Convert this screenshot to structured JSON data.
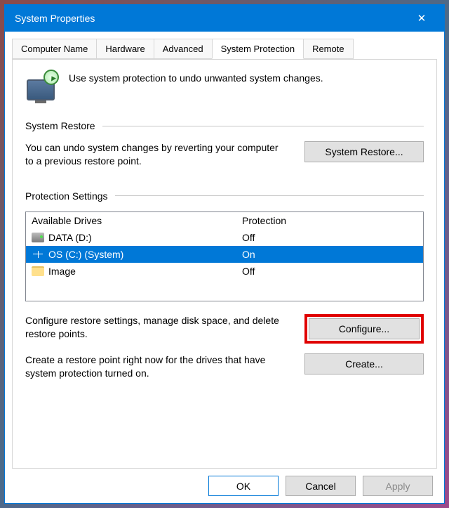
{
  "window": {
    "title": "System Properties"
  },
  "tabs": {
    "computer_name": "Computer Name",
    "hardware": "Hardware",
    "advanced": "Advanced",
    "system_protection": "System Protection",
    "remote": "Remote"
  },
  "intro_text": "Use system protection to undo unwanted system changes.",
  "restore": {
    "header": "System Restore",
    "desc": "You can undo system changes by reverting your computer to a previous restore point.",
    "button": "System Restore..."
  },
  "protection": {
    "header": "Protection Settings",
    "col_drives": "Available Drives",
    "col_protection": "Protection",
    "drives": [
      {
        "name": "DATA (D:)",
        "icon": "hdd",
        "protection": "Off",
        "selected": false
      },
      {
        "name": "OS (C:) (System)",
        "icon": "win",
        "protection": "On",
        "selected": true
      },
      {
        "name": "Image",
        "icon": "folder",
        "protection": "Off",
        "selected": false
      }
    ],
    "configure_desc": "Configure restore settings, manage disk space, and delete restore points.",
    "configure_btn": "Configure...",
    "create_desc": "Create a restore point right now for the drives that have system protection turned on.",
    "create_btn": "Create..."
  },
  "footer": {
    "ok": "OK",
    "cancel": "Cancel",
    "apply": "Apply"
  }
}
